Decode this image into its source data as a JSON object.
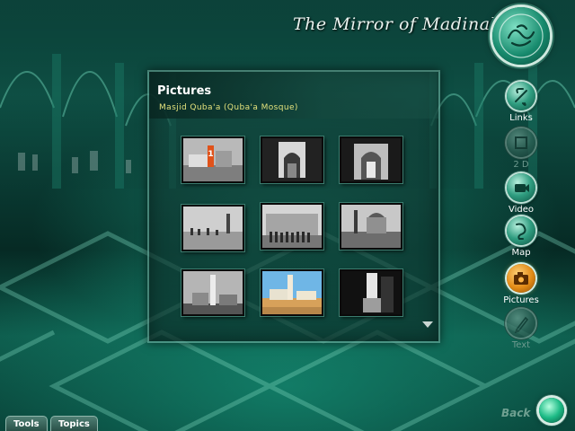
{
  "app": {
    "title": "The Mirror of Madinah"
  },
  "panel": {
    "title": "Pictures",
    "subtitle": "Masjid Quba'a (Quba'a Mosque)",
    "photos": [
      {
        "id": "photo-1",
        "style": "bw",
        "badge": "1"
      },
      {
        "id": "photo-2",
        "style": "bw"
      },
      {
        "id": "photo-3",
        "style": "bw"
      },
      {
        "id": "photo-4",
        "style": "bw"
      },
      {
        "id": "photo-5",
        "style": "bw"
      },
      {
        "id": "photo-6",
        "style": "bw"
      },
      {
        "id": "photo-7",
        "style": "bw"
      },
      {
        "id": "photo-8",
        "style": "color"
      },
      {
        "id": "photo-9",
        "style": "bw"
      }
    ]
  },
  "nav": {
    "items": [
      {
        "label": "Links",
        "icon": "link-icon",
        "state": "enabled"
      },
      {
        "label": "2 D",
        "icon": "square-icon",
        "state": "disabled"
      },
      {
        "label": "Video",
        "icon": "video-camera-icon",
        "state": "enabled"
      },
      {
        "label": "Map",
        "icon": "map-icon",
        "state": "enabled"
      },
      {
        "label": "Pictures",
        "icon": "camera-icon",
        "state": "active"
      },
      {
        "label": "Text",
        "icon": "pen-icon",
        "state": "disabled"
      }
    ]
  },
  "bottom": {
    "tools_label": "Tools",
    "topics_label": "Topics",
    "back_label": "Back"
  },
  "colors": {
    "accent_green": "#178a6d",
    "subtitle_yellow": "#e4e27c",
    "active_orange": "#e28a16"
  }
}
